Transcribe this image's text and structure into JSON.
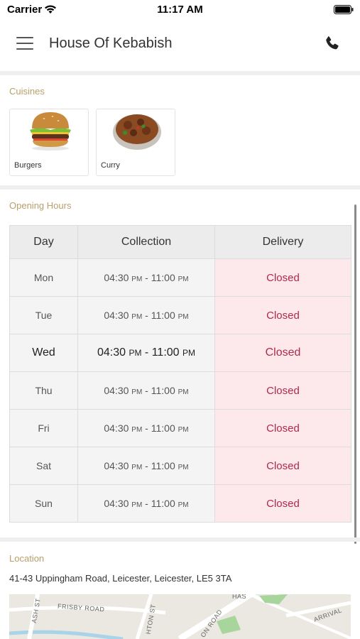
{
  "status_bar": {
    "carrier": "Carrier",
    "time": "11:17 AM"
  },
  "header": {
    "title": "House Of Kebabish"
  },
  "cuisines": {
    "label": "Cuisines",
    "items": [
      {
        "name": "Burgers",
        "icon": "burger-image"
      },
      {
        "name": "Curry",
        "icon": "curry-image"
      }
    ]
  },
  "opening_hours": {
    "label": "Opening Hours",
    "columns": [
      "Day",
      "Collection",
      "Delivery"
    ],
    "rows": [
      {
        "day": "Mon",
        "open": "04:30",
        "open_ampm": "PM",
        "sep": " - ",
        "close": "11:00",
        "close_ampm": "PM",
        "delivery": "Closed"
      },
      {
        "day": "Tue",
        "open": "04:30",
        "open_ampm": "PM",
        "sep": " - ",
        "close": "11:00",
        "close_ampm": "PM",
        "delivery": "Closed"
      },
      {
        "day": "Wed",
        "open": "04:30",
        "open_ampm": "PM",
        "sep": " - ",
        "close": "11:00",
        "close_ampm": "PM",
        "delivery": "Closed"
      },
      {
        "day": "Thu",
        "open": "04:30",
        "open_ampm": "PM",
        "sep": " - ",
        "close": "11:00",
        "close_ampm": "PM",
        "delivery": "Closed"
      },
      {
        "day": "Fri",
        "open": "04:30",
        "open_ampm": "PM",
        "sep": " - ",
        "close": "11:00",
        "close_ampm": "PM",
        "delivery": "Closed"
      },
      {
        "day": "Sat",
        "open": "04:30",
        "open_ampm": "PM",
        "sep": " - ",
        "close": "11:00",
        "close_ampm": "PM",
        "delivery": "Closed"
      },
      {
        "day": "Sun",
        "open": "04:30",
        "open_ampm": "PM",
        "sep": " - ",
        "close": "11:00",
        "close_ampm": "PM",
        "delivery": "Closed"
      }
    ]
  },
  "location": {
    "label": "Location",
    "address": "41-43 Uppingham Road, Leicester, Leicester, LE5 3TA",
    "map_labels": [
      "ASH ST",
      "FRISBY ROAD",
      "HTON ST",
      "ON ROAD",
      "HAS",
      "ARRIVAL"
    ]
  },
  "colors": {
    "accent_label": "#b8a06a",
    "closed_text": "#b0294a",
    "closed_bg": "#fde9ec"
  }
}
